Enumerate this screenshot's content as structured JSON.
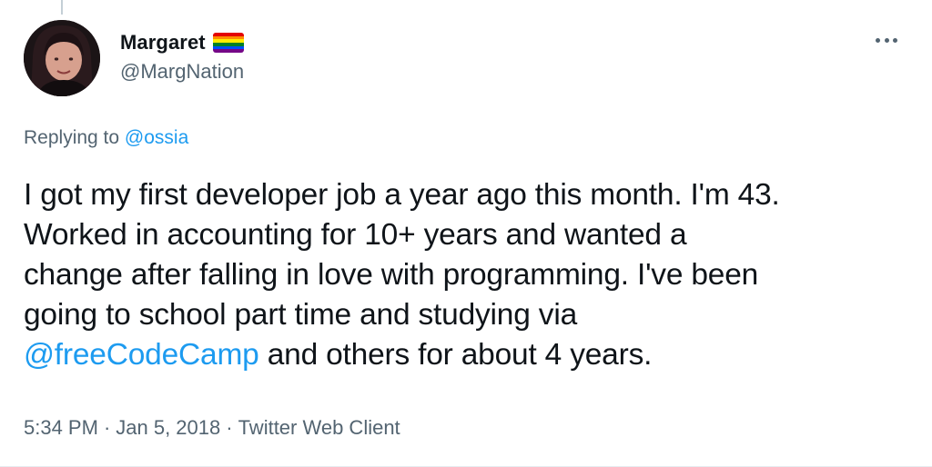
{
  "tweet": {
    "author": {
      "display_name": "Margaret",
      "handle": "@MargNation",
      "avatar_icon": "user-avatar-photo",
      "name_emoji": "rainbow-flag"
    },
    "more_icon": "ellipsis-icon",
    "reply_context": {
      "prefix": "Replying to",
      "mention": "@ossia"
    },
    "body": {
      "line1": "I got my first developer job a year ago this month. I'm 43.",
      "line2": "Worked in accounting for 10+ years and wanted a",
      "line3": "change after falling in love with programming. I've been",
      "line4": "going to school part time and studying via",
      "line5_mention": "@freeCodeCamp",
      "line5_rest": " and others for about 4 years."
    },
    "meta": {
      "time": "5:34 PM",
      "separator": "·",
      "date": "Jan 5, 2018",
      "client": "Twitter Web Client"
    }
  },
  "colors": {
    "text": "#0f1419",
    "secondary": "#536471",
    "link": "#1d9bf0",
    "pride_flag": [
      "#e40303",
      "#ff8c00",
      "#ffed00",
      "#008026",
      "#004dff",
      "#750787"
    ]
  }
}
